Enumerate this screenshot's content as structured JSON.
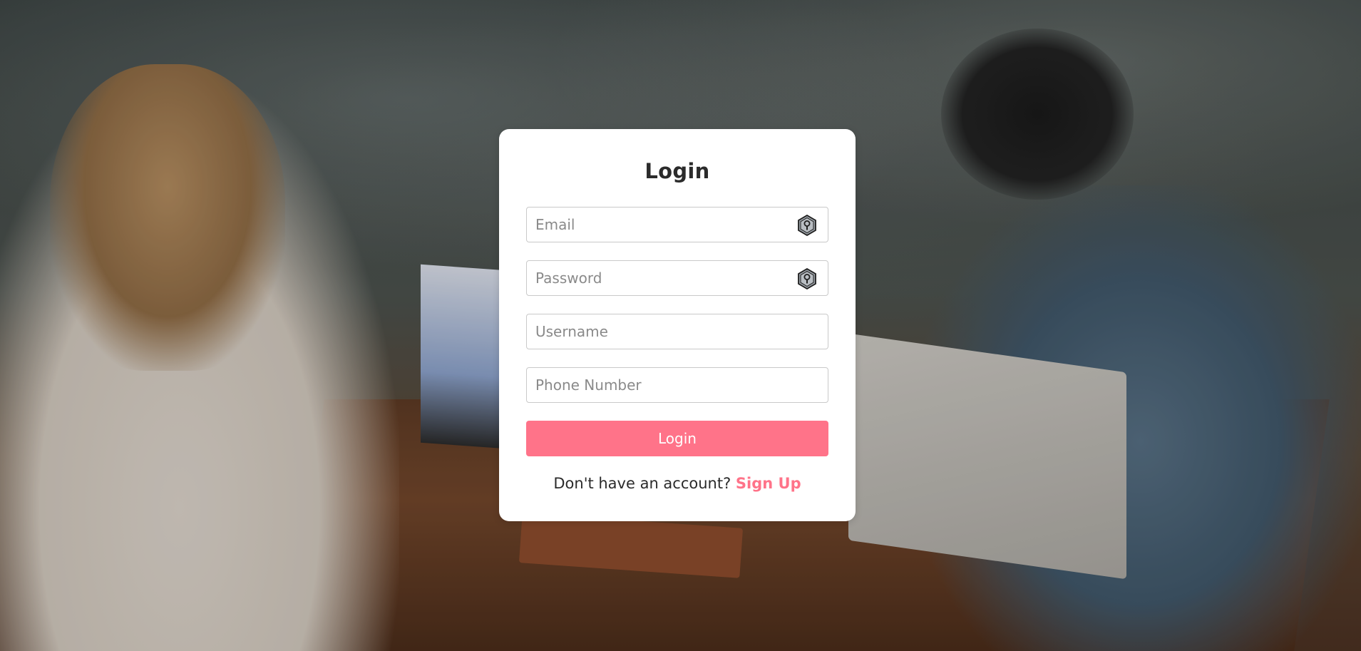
{
  "login": {
    "title": "Login",
    "email_placeholder": "Email",
    "password_placeholder": "Password",
    "username_placeholder": "Username",
    "phone_placeholder": "Phone Number",
    "submit_label": "Login",
    "signup_prompt": "Don't have an account?",
    "signup_link": "Sign Up"
  },
  "icons": {
    "email_field_icon": "keyhole-hexagon-icon",
    "password_field_icon": "keyhole-hexagon-icon"
  },
  "colors": {
    "accent": "#ff7389",
    "card_background": "#ffffff",
    "text": "#2b2b2b",
    "placeholder": "#8a8a8a"
  }
}
